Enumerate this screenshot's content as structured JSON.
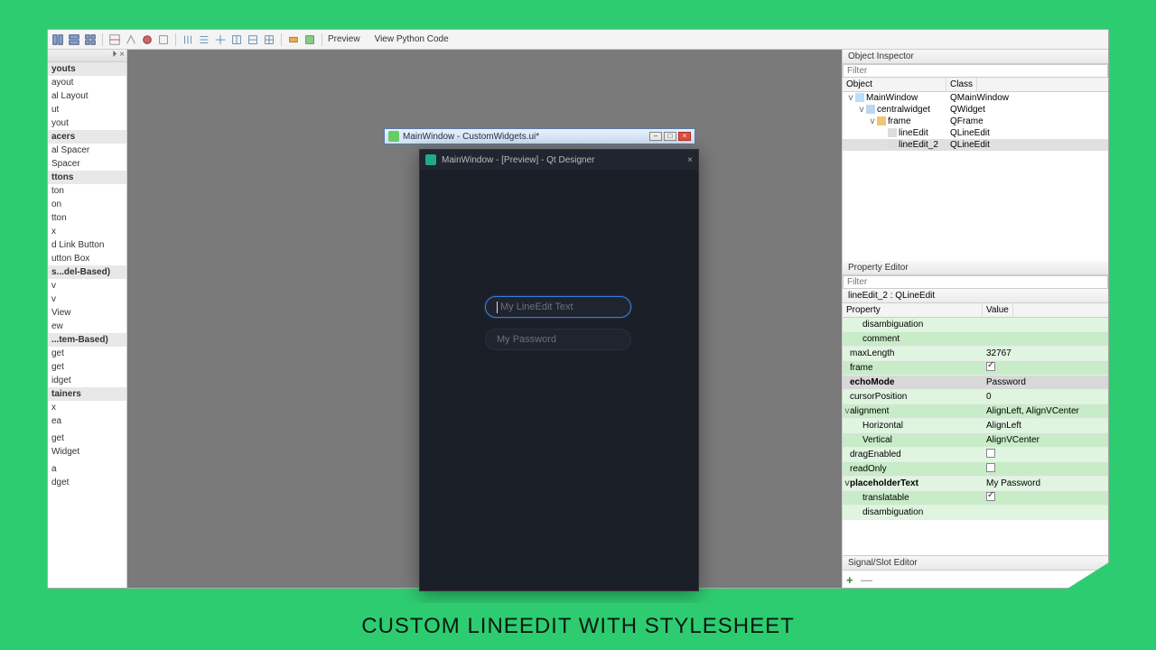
{
  "toolbar": {
    "preview_label": "Preview",
    "view_code_label": "View Python Code"
  },
  "widgetbox": {
    "close_glyph": "⏵ ×",
    "items": [
      {
        "label": "youts",
        "cat": true
      },
      {
        "label": "ayout"
      },
      {
        "label": "al Layout"
      },
      {
        "label": "ut"
      },
      {
        "label": "yout"
      },
      {
        "label": "acers",
        "cat": true
      },
      {
        "label": "al Spacer"
      },
      {
        "label": "Spacer"
      },
      {
        "label": "ttons",
        "cat": true
      },
      {
        "label": "ton"
      },
      {
        "label": "on"
      },
      {
        "label": "tton"
      },
      {
        "label": "x"
      },
      {
        "label": "d Link Button"
      },
      {
        "label": "utton Box"
      },
      {
        "label": "s...del-Based)",
        "cat": true
      },
      {
        "label": "v"
      },
      {
        "label": "v"
      },
      {
        "label": "View"
      },
      {
        "label": "ew"
      },
      {
        "label": "...tem-Based)",
        "cat": true
      },
      {
        "label": "get"
      },
      {
        "label": "get"
      },
      {
        "label": "idget"
      },
      {
        "label": "tainers",
        "cat": true
      },
      {
        "label": "x"
      },
      {
        "label": "ea"
      },
      {
        "label": ""
      },
      {
        "label": "get"
      },
      {
        "label": "Widget"
      },
      {
        "label": ""
      },
      {
        "label": "a"
      },
      {
        "label": "dget"
      }
    ]
  },
  "child_window": {
    "title": "MainWindow - CustomWidgets.ui*"
  },
  "preview": {
    "title": "MainWindow - [Preview] - Qt Designer",
    "lineedit1_placeholder": "My LineEdit Text",
    "lineedit2_placeholder": "My Password"
  },
  "object_inspector": {
    "title": "Object Inspector",
    "filter_placeholder": "Filter",
    "col_object": "Object",
    "col_class": "Class",
    "rows": [
      {
        "indent": 0,
        "exp": "v",
        "obj": "MainWindow",
        "cls": "QMainWindow",
        "icon": "#b7dfff"
      },
      {
        "indent": 1,
        "exp": "v",
        "obj": "centralwidget",
        "cls": "QWidget",
        "icon": "#bcd6ef"
      },
      {
        "indent": 2,
        "exp": "v",
        "obj": "frame",
        "cls": "QFrame",
        "icon": "#f0c674"
      },
      {
        "indent": 3,
        "exp": "",
        "obj": "lineEdit",
        "cls": "QLineEdit",
        "icon": "#ddd"
      },
      {
        "indent": 3,
        "exp": "",
        "obj": "lineEdit_2",
        "cls": "QLineEdit",
        "icon": "#ddd",
        "sel": true
      }
    ]
  },
  "property_editor": {
    "title": "Property Editor",
    "filter_placeholder": "Filter",
    "context": "lineEdit_2 : QLineEdit",
    "col_property": "Property",
    "col_value": "Value",
    "rows": [
      {
        "name": "disambiguation",
        "value": "",
        "indent": 1,
        "alt": 0
      },
      {
        "name": "comment",
        "value": "",
        "indent": 1,
        "alt": 1
      },
      {
        "name": "maxLength",
        "value": "32767",
        "alt": 0
      },
      {
        "name": "frame",
        "value": "__check_on",
        "alt": 1
      },
      {
        "name": "echoMode",
        "value": "Password",
        "bold": true,
        "sel": true
      },
      {
        "name": "cursorPosition",
        "value": "0",
        "alt": 0
      },
      {
        "name": "alignment",
        "value": "AlignLeft, AlignVCenter",
        "exp": "v",
        "alt": 1
      },
      {
        "name": "Horizontal",
        "value": "AlignLeft",
        "indent": 1,
        "alt": 0
      },
      {
        "name": "Vertical",
        "value": "AlignVCenter",
        "indent": 1,
        "alt": 1
      },
      {
        "name": "dragEnabled",
        "value": "__check_off",
        "alt": 0
      },
      {
        "name": "readOnly",
        "value": "__check_off",
        "alt": 1
      },
      {
        "name": "placeholderText",
        "value": "My Password",
        "bold": true,
        "exp": "v",
        "alt": 0
      },
      {
        "name": "translatable",
        "value": "__check_on",
        "indent": 1,
        "alt": 1
      },
      {
        "name": "disambiguation",
        "value": "",
        "indent": 1,
        "alt": 0
      }
    ]
  },
  "signal_editor": {
    "title": "Signal/Slot Editor"
  },
  "caption": "CUSTOM LINEEDIT WITH STYLESHEET"
}
